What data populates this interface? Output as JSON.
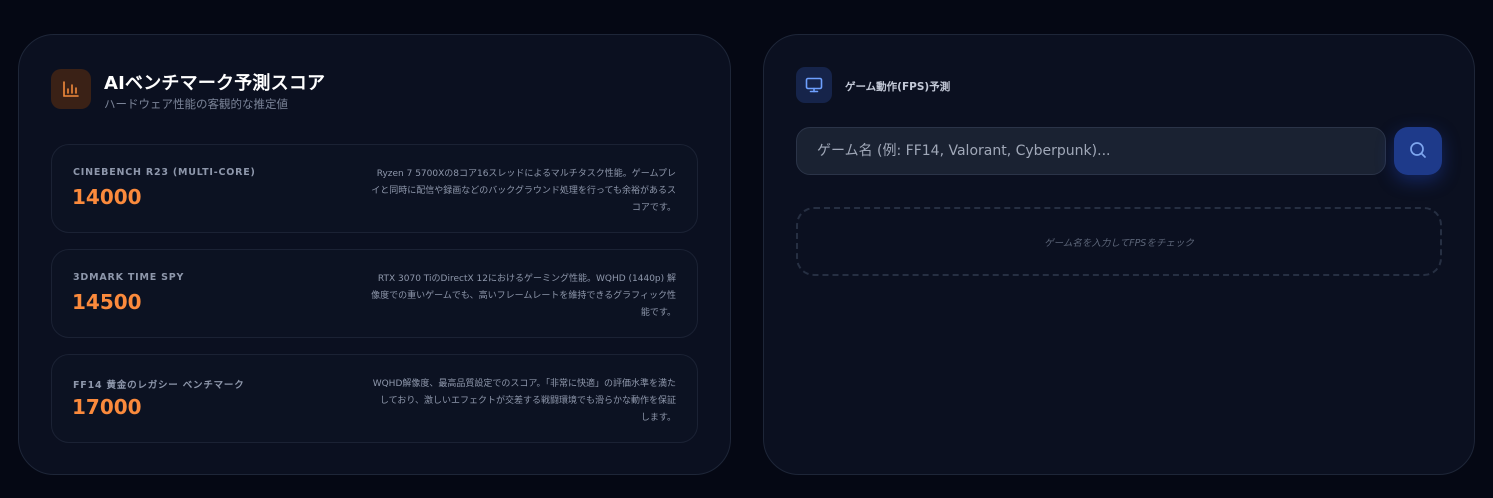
{
  "benchmarks_panel": {
    "title": "AIベンチマーク予測スコア",
    "subtitle": "ハードウェア性能の客観的な推定値",
    "icon": "bar-chart-icon",
    "items": [
      {
        "name": "CINEBENCH R23 (MULTI-CORE)",
        "score": "14000",
        "description": "Ryzen 7 5700Xの8コア16スレッドによるマルチタスク性能。ゲームプレイと同時に配信や録画などのバックグラウンド処理を行っても余裕があるスコアです。"
      },
      {
        "name": "3DMARK TIME SPY",
        "score": "14500",
        "description": "RTX 3070 TiのDirectX 12におけるゲーミング性能。WQHD (1440p) 解像度での重いゲームでも、高いフレームレートを維持できるグラフィック性能です。"
      },
      {
        "name": "FF14 黄金のレガシー ベンチマーク",
        "score": "17000",
        "description": "WQHD解像度、最高品質設定でのスコア。「非常に快適」の評価水準を満たしており、激しいエフェクトが交差する戦闘環境でも滑らかな動作を保証します。"
      }
    ]
  },
  "fps_panel": {
    "title": "ゲーム動作(FPS)予測",
    "icon": "monitor-icon",
    "search": {
      "placeholder": "ゲーム名 (例: FF14, Valorant, Cyberpunk)...",
      "value": "",
      "button_icon": "search-icon"
    },
    "empty_message": "ゲーム名を入力してFPSをチェック"
  },
  "colors": {
    "score": "#fb8a3c",
    "accent_blue": "#1e3a8a",
    "background": "#050814",
    "panel": "#0b1020"
  }
}
